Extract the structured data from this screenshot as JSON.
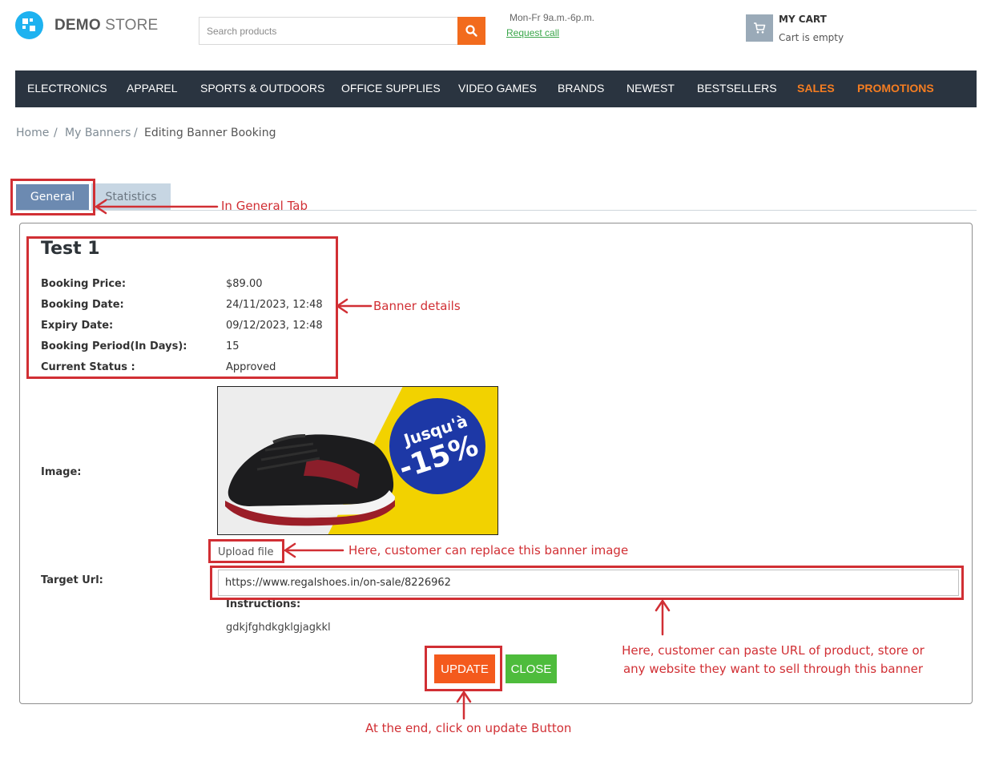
{
  "header": {
    "logo_brand": "DEMO",
    "logo_suffix": "STORE",
    "search_placeholder": "Search products",
    "hours": "Mon-Fr 9a.m.-6p.m.",
    "request_call": "Request call",
    "cart_title": "MY CART",
    "cart_status": "Cart is empty"
  },
  "nav": {
    "items": [
      {
        "label": "ELECTRONICS"
      },
      {
        "label": "APPAREL"
      },
      {
        "label": "SPORTS & OUTDOORS"
      },
      {
        "label": "OFFICE SUPPLIES"
      },
      {
        "label": "VIDEO GAMES"
      },
      {
        "label": "BRANDS"
      },
      {
        "label": "NEWEST"
      },
      {
        "label": "BESTSELLERS"
      },
      {
        "label": "SALES"
      },
      {
        "label": "PROMOTIONS"
      }
    ]
  },
  "breadcrumb": {
    "home": "Home",
    "parent": "My Banners",
    "current": "Editing Banner Booking",
    "separator": "/"
  },
  "tabs": {
    "general": "General",
    "statistics": "Statistics"
  },
  "banner": {
    "title": "Test 1",
    "fields": [
      {
        "label": "Booking Price:",
        "value": "$89.00"
      },
      {
        "label": "Booking Date:",
        "value": "24/11/2023, 12:48"
      },
      {
        "label": "Expiry Date:",
        "value": "09/12/2023, 12:48"
      },
      {
        "label": "Booking Period(In Days):",
        "value": "15"
      },
      {
        "label": "Current Status :",
        "value": "Approved"
      }
    ],
    "image_label": "Image:",
    "image_text_line1": "Jusqu'à",
    "image_text_line2": "-15%",
    "upload_label": "Upload file",
    "target_url_label": "Target Url:",
    "target_url_value": "https://www.regalshoes.in/on-sale/8226962",
    "instructions_label": "Instructions:",
    "instructions_text": "gdkjfghdkgklgjagkkl",
    "update_button": "UPDATE",
    "close_button": "CLOSE"
  },
  "annotations": {
    "general_tab": "In General Tab",
    "banner_details": "Banner details",
    "replace_image": "Here, customer can replace this banner image",
    "paste_url_line1": "Here, customer can paste URL of product, store or",
    "paste_url_line2": "any website they want to sell through this banner",
    "click_update": "At the end, click on update Button"
  },
  "colors": {
    "nav_bg": "#2a3440",
    "accent_orange": "#f26b1d",
    "update_button": "#f45a1d",
    "close_button": "#4ebc3c",
    "tab_active": "#6c8ab1",
    "tab_inactive": "#c7d6e3",
    "annotation_red": "#d12f34"
  }
}
